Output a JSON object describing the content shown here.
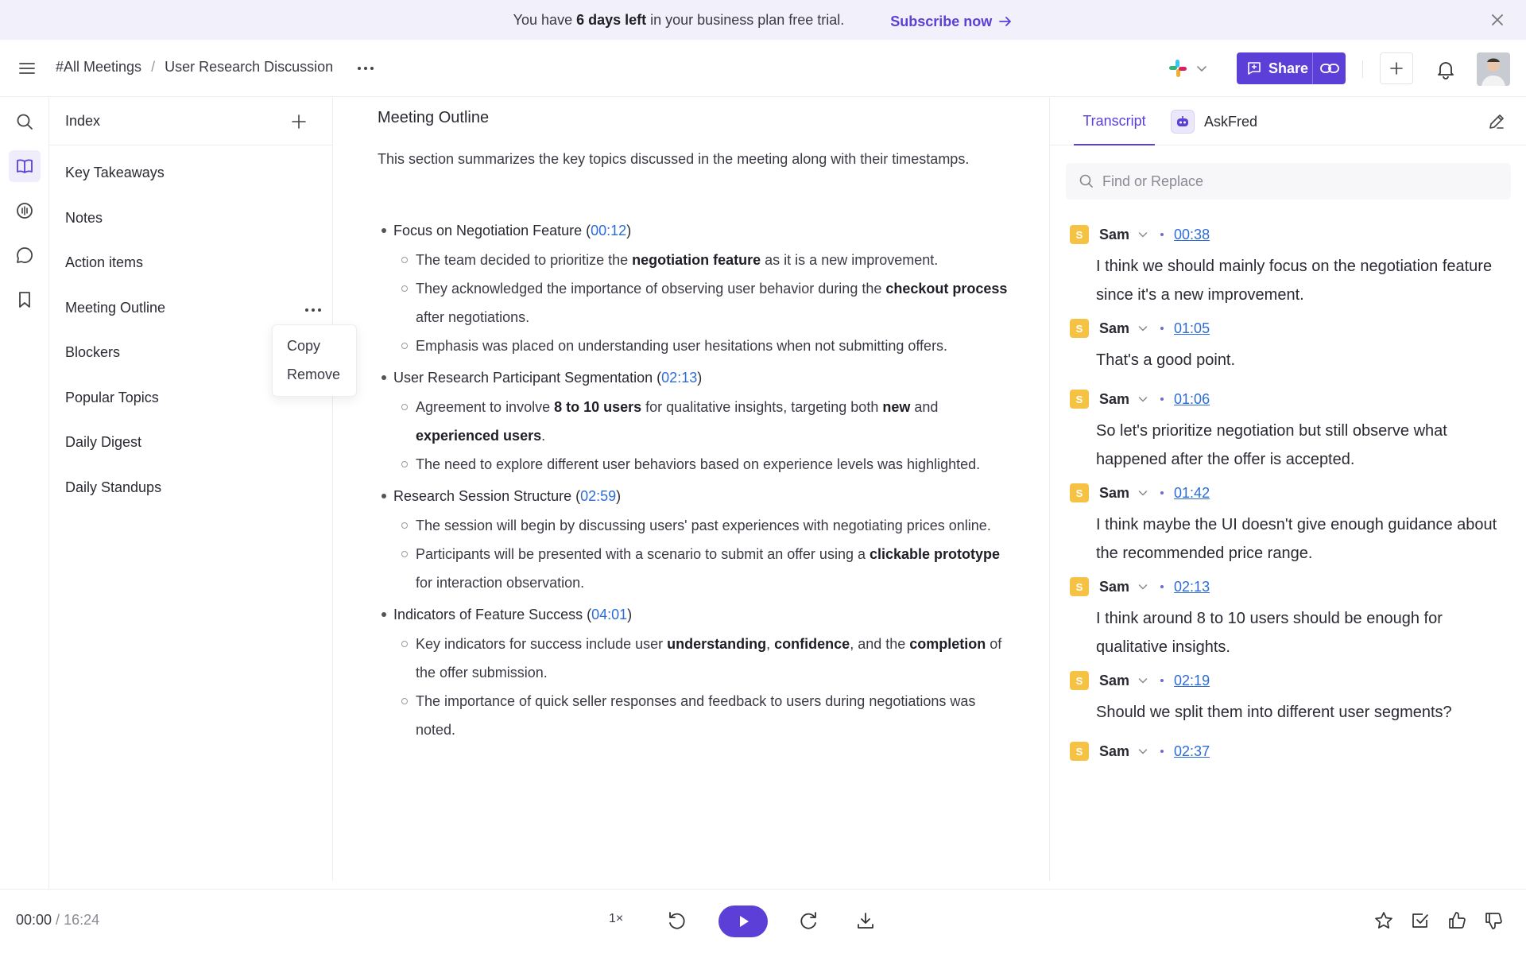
{
  "banner": {
    "prefix": "You have ",
    "highlight": "6 days left",
    "suffix": " in your business plan free trial.",
    "cta": "Subscribe now"
  },
  "header": {
    "breadcrumb_root": "#All Meetings",
    "breadcrumb_sep": "/",
    "breadcrumb_current": "User Research Discussion",
    "share_label": "Share"
  },
  "index": {
    "title": "Index",
    "items": [
      "Key Takeaways",
      "Notes",
      "Action items",
      "Meeting Outline",
      "Blockers",
      "Popular Topics",
      "Daily Digest",
      "Daily Standups"
    ],
    "menu": [
      "Copy",
      "Remove"
    ]
  },
  "main": {
    "title": "Meeting Outline",
    "intro": "This section summarizes the key topics discussed in the meeting along with their timestamps.",
    "topics": [
      {
        "title": "Focus on Negotiation Feature",
        "time": "00:12",
        "points": [
          [
            {
              "t": "The team decided to prioritize the "
            },
            {
              "t": "negotiation feature",
              "b": true
            },
            {
              "t": " as it is a new improvement."
            }
          ],
          [
            {
              "t": "They acknowledged the importance of observing user behavior during the "
            },
            {
              "t": "checkout process",
              "b": true
            },
            {
              "t": " after negotiations."
            }
          ],
          [
            {
              "t": "Emphasis was placed on understanding user hesitations when not submitting offers."
            }
          ]
        ]
      },
      {
        "title": "User Research Participant Segmentation",
        "time": "02:13",
        "points": [
          [
            {
              "t": "Agreement to involve "
            },
            {
              "t": "8 to 10 users",
              "b": true
            },
            {
              "t": " for qualitative insights, targeting both "
            },
            {
              "t": "new",
              "b": true
            },
            {
              "t": " and "
            },
            {
              "t": "experienced users",
              "b": true
            },
            {
              "t": "."
            }
          ],
          [
            {
              "t": "The need to explore different user behaviors based on experience levels was highlighted."
            }
          ]
        ]
      },
      {
        "title": "Research Session Structure",
        "time": "02:59",
        "points": [
          [
            {
              "t": "The session will begin by discussing users' past experiences with negotiating prices online."
            }
          ],
          [
            {
              "t": "Participants will be presented with a scenario to submit an offer using a "
            },
            {
              "t": "clickable prototype",
              "b": true
            },
            {
              "t": " for interaction observation."
            }
          ]
        ]
      },
      {
        "title": "Indicators of Feature Success",
        "time": "04:01",
        "points": [
          [
            {
              "t": "Key indicators for success include user "
            },
            {
              "t": "understanding",
              "b": true
            },
            {
              "t": ", "
            },
            {
              "t": "confidence",
              "b": true
            },
            {
              "t": ", and the "
            },
            {
              "t": "completion",
              "b": true
            },
            {
              "t": " of the offer submission."
            }
          ],
          [
            {
              "t": "The importance of quick seller responses and feedback to users during negotiations was noted."
            }
          ]
        ]
      }
    ]
  },
  "transcript": {
    "tab_transcript": "Transcript",
    "tab_askfred": "AskFred",
    "search_placeholder": "Find or Replace",
    "entries": [
      {
        "initial": "S",
        "speaker": "Sam",
        "time": "00:38",
        "text": "I think we should mainly focus on the negotiation feature since it's a new improvement."
      },
      {
        "initial": "S",
        "speaker": "Sam",
        "time": "01:05",
        "text": "That's a good point."
      },
      {
        "initial": "S",
        "speaker": "Sam",
        "time": "01:06",
        "text": "So let's prioritize negotiation but still observe what happened after the offer is accepted."
      },
      {
        "initial": "S",
        "speaker": "Sam",
        "time": "01:42",
        "text": "I think maybe the UI doesn't give enough guidance about the recommended price range."
      },
      {
        "initial": "S",
        "speaker": "Sam",
        "time": "02:13",
        "text": "I think around 8 to 10 users should be enough for qualitative insights."
      },
      {
        "initial": "S",
        "speaker": "Sam",
        "time": "02:19",
        "text": "Should we split them into different user segments?"
      },
      {
        "initial": "S",
        "speaker": "Sam",
        "time": "02:37",
        "text": ""
      }
    ]
  },
  "player": {
    "current": "00:00",
    "sep": " / ",
    "duration": "16:24",
    "speed": "1×"
  },
  "colors": {
    "accent": "#5b3fd6",
    "link": "#2d6cd6",
    "speaker_badge": "#f6c244",
    "banner_bg": "#f2f0fb"
  },
  "icons": [
    "close-icon",
    "menu-icon",
    "more-icon",
    "slack-icon",
    "share-icon",
    "link-icon",
    "plus-icon",
    "bell-icon",
    "search-icon",
    "book-icon",
    "audio-icon",
    "chat-icon",
    "bookmark-icon",
    "pencil-icon",
    "chevron-down-icon",
    "rewind-icon",
    "play-icon",
    "forward-icon",
    "download-icon",
    "star-icon",
    "checkbox-icon",
    "thumbs-up-icon",
    "thumbs-down-icon"
  ]
}
